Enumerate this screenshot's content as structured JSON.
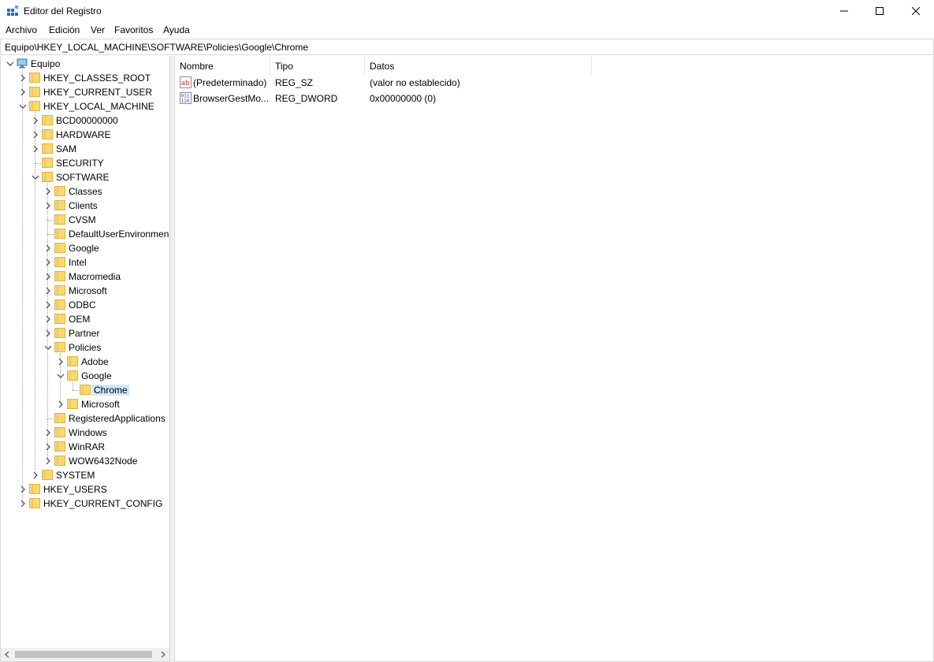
{
  "window": {
    "title": "Editor del Registro"
  },
  "menu": {
    "items": [
      "Archivo",
      "Edición",
      "Ver",
      "Favoritos",
      "Ayuda"
    ]
  },
  "address": {
    "path": "Equipo\\HKEY_LOCAL_MACHINE\\SOFTWARE\\Policies\\Google\\Chrome"
  },
  "tree": {
    "nodes": [
      {
        "label": "Equipo",
        "level": 0,
        "state": "expanded",
        "icon": "computer-icon"
      },
      {
        "label": "HKEY_CLASSES_ROOT",
        "level": 1,
        "state": "collapsed"
      },
      {
        "label": "HKEY_CURRENT_USER",
        "level": 1,
        "state": "collapsed"
      },
      {
        "label": "HKEY_LOCAL_MACHINE",
        "level": 1,
        "state": "expanded"
      },
      {
        "label": "BCD00000000",
        "level": 2,
        "state": "collapsed"
      },
      {
        "label": "HARDWARE",
        "level": 2,
        "state": "collapsed"
      },
      {
        "label": "SAM",
        "level": 2,
        "state": "collapsed"
      },
      {
        "label": "SECURITY",
        "level": 2,
        "state": "leaf"
      },
      {
        "label": "SOFTWARE",
        "level": 2,
        "state": "expanded"
      },
      {
        "label": "Classes",
        "level": 3,
        "state": "collapsed"
      },
      {
        "label": "Clients",
        "level": 3,
        "state": "collapsed"
      },
      {
        "label": "CVSM",
        "level": 3,
        "state": "leaf"
      },
      {
        "label": "DefaultUserEnvironmen",
        "level": 3,
        "state": "leaf"
      },
      {
        "label": "Google",
        "level": 3,
        "state": "collapsed"
      },
      {
        "label": "Intel",
        "level": 3,
        "state": "collapsed"
      },
      {
        "label": "Macromedia",
        "level": 3,
        "state": "collapsed"
      },
      {
        "label": "Microsoft",
        "level": 3,
        "state": "collapsed"
      },
      {
        "label": "ODBC",
        "level": 3,
        "state": "collapsed"
      },
      {
        "label": "OEM",
        "level": 3,
        "state": "collapsed"
      },
      {
        "label": "Partner",
        "level": 3,
        "state": "collapsed"
      },
      {
        "label": "Policies",
        "level": 3,
        "state": "expanded"
      },
      {
        "label": "Adobe",
        "level": 4,
        "state": "collapsed"
      },
      {
        "label": "Google",
        "level": 4,
        "state": "expanded"
      },
      {
        "label": "Chrome",
        "level": 5,
        "state": "leaf",
        "selected": true
      },
      {
        "label": "Microsoft",
        "level": 4,
        "state": "collapsed"
      },
      {
        "label": "RegisteredApplications",
        "level": 3,
        "state": "leaf"
      },
      {
        "label": "Windows",
        "level": 3,
        "state": "collapsed"
      },
      {
        "label": "WinRAR",
        "level": 3,
        "state": "collapsed"
      },
      {
        "label": "WOW6432Node",
        "level": 3,
        "state": "collapsed"
      },
      {
        "label": "SYSTEM",
        "level": 2,
        "state": "collapsed"
      },
      {
        "label": "HKEY_USERS",
        "level": 1,
        "state": "collapsed"
      },
      {
        "label": "HKEY_CURRENT_CONFIG",
        "level": 1,
        "state": "collapsed"
      }
    ]
  },
  "list": {
    "columns": [
      "Nombre",
      "Tipo",
      "Datos"
    ],
    "rows": [
      {
        "icon": "string-value-icon",
        "name": "(Predeterminado)",
        "type": "REG_SZ",
        "data": "(valor no establecido)"
      },
      {
        "icon": "binary-value-icon",
        "name": "BrowserGestMo...",
        "type": "REG_DWORD",
        "data": "0x00000000 (0)"
      }
    ]
  },
  "colors": {
    "folder": "#f8d775",
    "folder_edge": "#e0b43c",
    "selection": "#cce8ff",
    "border": "#d9d9d9"
  }
}
